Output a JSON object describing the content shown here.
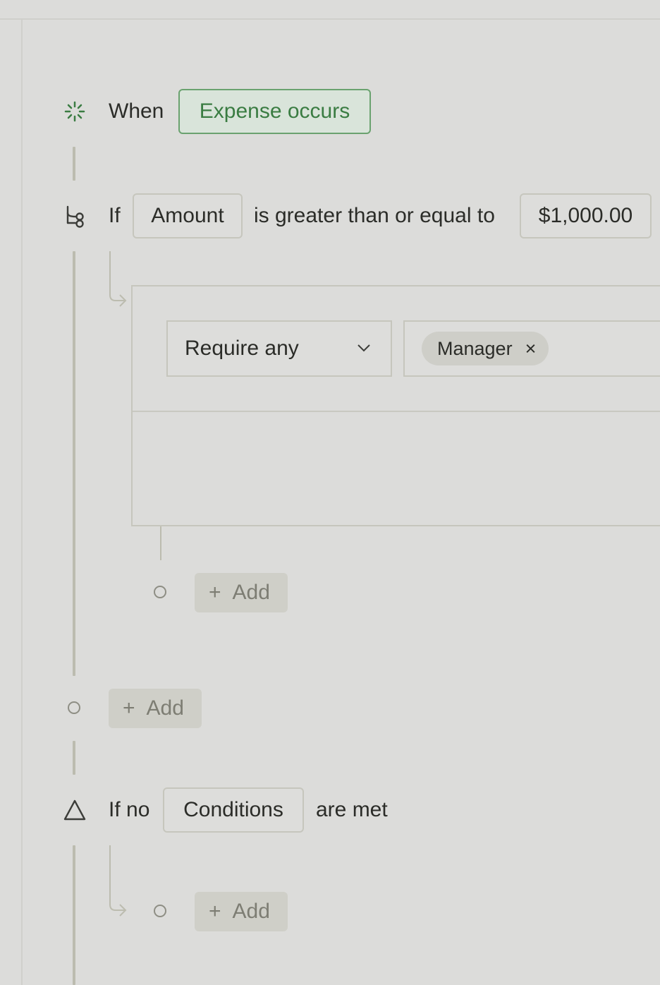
{
  "trigger": {
    "prefix": "When",
    "event": "Expense occurs"
  },
  "condition": {
    "prefix": "If",
    "field": "Amount",
    "operator": "is greater than or equal to",
    "value": "$1,000.00"
  },
  "action": {
    "mode": "Require any",
    "approvers": [
      {
        "label": "Manager",
        "remove": "×"
      }
    ]
  },
  "add_labels": {
    "plus": "+",
    "text": "Add"
  },
  "fallback": {
    "prefix": "If no",
    "field": "Conditions",
    "suffix": "are met"
  },
  "colors": {
    "background": "#dcdcda",
    "accent_green": "#3a7c42",
    "rail": "#bcbcaf"
  },
  "icons": {
    "trigger": "sparkle-loader-icon",
    "condition": "branch-icon",
    "fallback": "triangle-warning-icon",
    "dropdown": "chevron-down-icon",
    "remove": "close-icon"
  }
}
